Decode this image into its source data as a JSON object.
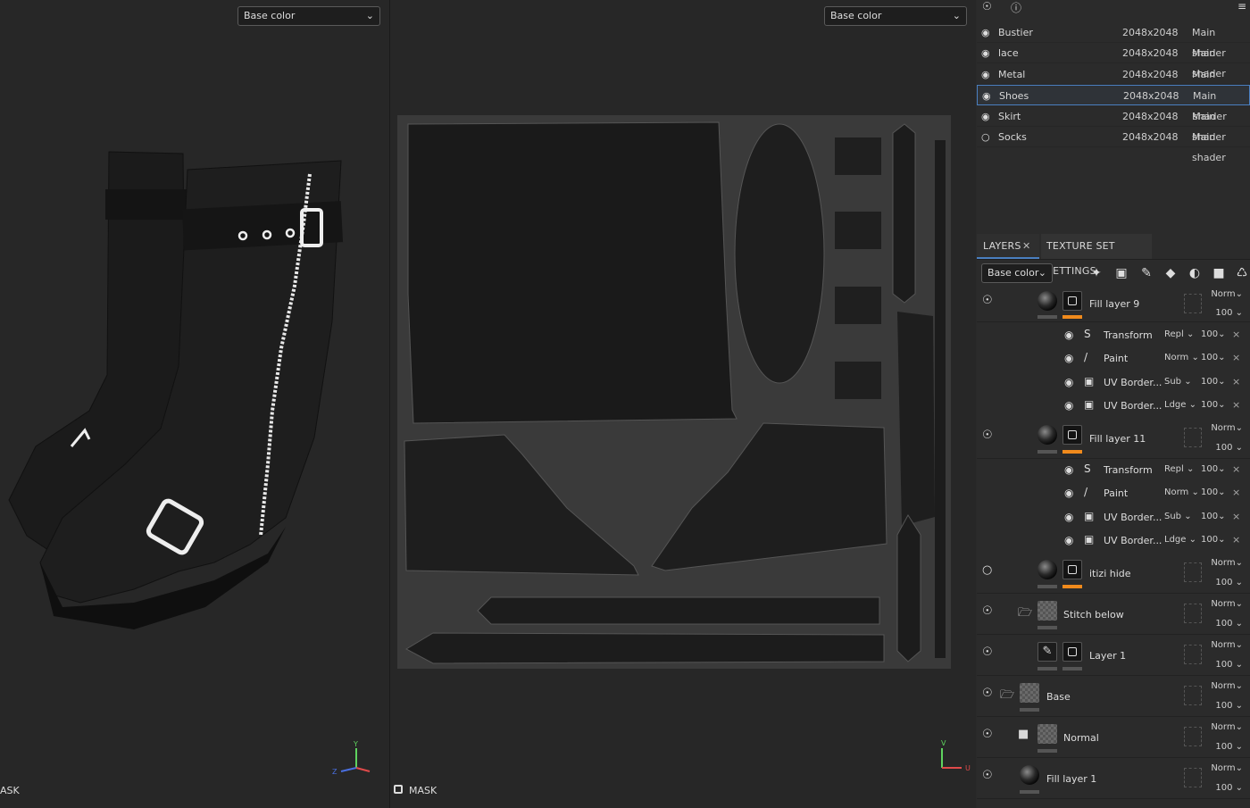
{
  "viewport3d": {
    "channel": "Base color",
    "mask_label": "ASK",
    "axes": {
      "y": "Y",
      "z": "Z"
    }
  },
  "viewport2d": {
    "channel": "Base color",
    "mask_label": "MASK",
    "axes": {
      "v": "V",
      "u": "U"
    }
  },
  "texture_sets": [
    {
      "name": "Bustier",
      "resolution": "2048x2048",
      "shader": "Main shader",
      "visible": true,
      "selected": false
    },
    {
      "name": "lace",
      "resolution": "2048x2048",
      "shader": "Main shader",
      "visible": true,
      "selected": false
    },
    {
      "name": "Metal",
      "resolution": "2048x2048",
      "shader": "Main shader",
      "visible": true,
      "selected": false
    },
    {
      "name": "Shoes",
      "resolution": "2048x2048",
      "shader": "Main shader",
      "visible": true,
      "selected": true
    },
    {
      "name": "Skirt",
      "resolution": "2048x2048",
      "shader": "Main shader",
      "visible": true,
      "selected": false
    },
    {
      "name": "Socks",
      "resolution": "2048x2048",
      "shader": "Main shader",
      "visible": false,
      "selected": false
    }
  ],
  "tabs": {
    "layers": "LAYERS",
    "close": "✕",
    "texture_set_settings": "TEXTURE SET SETTINGS"
  },
  "layers_toolbar": {
    "channel": "Base color"
  },
  "layers": {
    "fill9": {
      "name": "Fill layer 9",
      "blend": "Norm",
      "opacity": "100"
    },
    "fill11": {
      "name": "Fill layer 11",
      "blend": "Norm",
      "opacity": "100"
    },
    "itizi": {
      "name": "itizi hide",
      "blend": "Norm",
      "opacity": "100"
    },
    "stitch": {
      "name": "Stitch below",
      "blend": "Norm",
      "opacity": "100"
    },
    "layer1": {
      "name": "Layer 1",
      "blend": "Norm",
      "opacity": "100"
    },
    "base": {
      "name": "Base",
      "blend": "Norm",
      "opacity": "100"
    },
    "normal": {
      "name": "Normal",
      "blend": "Norm",
      "opacity": "100"
    },
    "filllayer1": {
      "name": "Fill layer 1",
      "blend": "Norm",
      "opacity": "100"
    }
  },
  "effects_fill9": [
    {
      "name": "Transform",
      "mode": "Repl",
      "opacity": "100"
    },
    {
      "name": "Paint",
      "mode": "Norm",
      "opacity": "100"
    },
    {
      "name": "UV Border...",
      "mode": "Sub",
      "opacity": "100"
    },
    {
      "name": "UV Border...",
      "mode": "Ldge",
      "opacity": "100"
    }
  ],
  "effects_fill11": [
    {
      "name": "Transform",
      "mode": "Repl",
      "opacity": "100"
    },
    {
      "name": "Paint",
      "mode": "Norm",
      "opacity": "100"
    },
    {
      "name": "UV Border...",
      "mode": "Sub",
      "opacity": "100"
    },
    {
      "name": "UV Border...",
      "mode": "Ldge",
      "opacity": "100"
    }
  ],
  "glyphs": {
    "dropdown": "⌄",
    "eye": "◉",
    "eye_off": "○",
    "close": "×"
  }
}
